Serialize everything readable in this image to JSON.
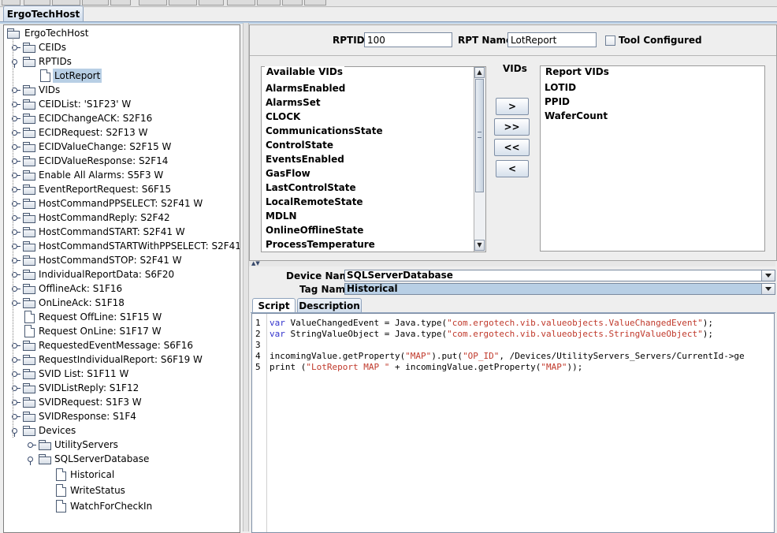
{
  "window": {
    "tab_label": "ErgoTechHost"
  },
  "tree": {
    "root": "ErgoTechHost",
    "items": [
      {
        "label": "CEIDs",
        "kind": "folder",
        "level": 1,
        "toggle": "closed"
      },
      {
        "label": "RPTIDs",
        "kind": "folder",
        "level": 1,
        "toggle": "open"
      },
      {
        "label": "LotReport",
        "kind": "leaf",
        "level": 2,
        "toggle": "none",
        "selected": true
      },
      {
        "label": "VIDs",
        "kind": "folder",
        "level": 1,
        "toggle": "closed"
      },
      {
        "label": "CEIDList: 'S1F23' W",
        "kind": "folder",
        "level": 1,
        "toggle": "closed"
      },
      {
        "label": "ECIDChangeACK: S2F16",
        "kind": "folder",
        "level": 1,
        "toggle": "closed"
      },
      {
        "label": "ECIDRequest: S2F13 W",
        "kind": "folder",
        "level": 1,
        "toggle": "closed"
      },
      {
        "label": "ECIDValueChange: S2F15 W",
        "kind": "folder",
        "level": 1,
        "toggle": "closed"
      },
      {
        "label": "ECIDValueResponse: S2F14",
        "kind": "folder",
        "level": 1,
        "toggle": "closed"
      },
      {
        "label": "Enable All Alarms: S5F3 W",
        "kind": "folder",
        "level": 1,
        "toggle": "closed"
      },
      {
        "label": "EventReportRequest: S6F15",
        "kind": "folder",
        "level": 1,
        "toggle": "closed"
      },
      {
        "label": "HostCommandPPSELECT: S2F41 W",
        "kind": "folder",
        "level": 1,
        "toggle": "closed"
      },
      {
        "label": "HostCommandReply: S2F42",
        "kind": "folder",
        "level": 1,
        "toggle": "closed"
      },
      {
        "label": "HostCommandSTART: S2F41 W",
        "kind": "folder",
        "level": 1,
        "toggle": "closed"
      },
      {
        "label": "HostCommandSTARTWithPPSELECT: S2F41",
        "kind": "folder",
        "level": 1,
        "toggle": "closed"
      },
      {
        "label": "HostCommandSTOP: S2F41 W",
        "kind": "folder",
        "level": 1,
        "toggle": "closed"
      },
      {
        "label": "IndividualReportData: S6F20",
        "kind": "folder",
        "level": 1,
        "toggle": "closed"
      },
      {
        "label": "OfflineAck: S1F16",
        "kind": "folder",
        "level": 1,
        "toggle": "closed"
      },
      {
        "label": "OnLineAck: S1F18",
        "kind": "folder",
        "level": 1,
        "toggle": "closed"
      },
      {
        "label": "Request OffLine: S1F15 W",
        "kind": "leaf",
        "level": 1,
        "toggle": "none"
      },
      {
        "label": "Request OnLine: S1F17 W",
        "kind": "leaf",
        "level": 1,
        "toggle": "none"
      },
      {
        "label": "RequestedEventMessage: S6F16",
        "kind": "folder",
        "level": 1,
        "toggle": "closed"
      },
      {
        "label": "RequestIndividualReport: S6F19 W",
        "kind": "folder",
        "level": 1,
        "toggle": "closed"
      },
      {
        "label": "SVID List: S1F11 W",
        "kind": "folder",
        "level": 1,
        "toggle": "closed"
      },
      {
        "label": "SVIDListReply: S1F12",
        "kind": "folder",
        "level": 1,
        "toggle": "closed"
      },
      {
        "label": "SVIDRequest: S1F3 W",
        "kind": "folder",
        "level": 1,
        "toggle": "closed"
      },
      {
        "label": "SVIDResponse: S1F4",
        "kind": "folder",
        "level": 1,
        "toggle": "closed"
      },
      {
        "label": "Devices",
        "kind": "folder",
        "level": 1,
        "toggle": "open"
      },
      {
        "label": "UtilityServers",
        "kind": "folder",
        "level": 2,
        "toggle": "closed"
      },
      {
        "label": "SQLServerDatabase",
        "kind": "folder",
        "level": 2,
        "toggle": "open"
      },
      {
        "label": "Historical",
        "kind": "leaf",
        "level": 3,
        "toggle": "none"
      },
      {
        "label": "WriteStatus",
        "kind": "leaf",
        "level": 3,
        "toggle": "none"
      },
      {
        "label": "WatchForCheckIn",
        "kind": "leaf",
        "level": 3,
        "toggle": "none"
      }
    ]
  },
  "report": {
    "rptid_label": "RPTID",
    "rptid_value": "100",
    "rpt_name_label": "RPT Name",
    "rpt_name_value": "LotReport",
    "tool_configured_label": "Tool Configured",
    "tool_configured_checked": false,
    "vids_label": "VIDs",
    "available_title": "Available VIDs",
    "available": [
      "AlarmsEnabled",
      "AlarmsSet",
      "CLOCK",
      "CommunicationsState",
      "ControlState",
      "EventsEnabled",
      "GasFlow",
      "LastControlState",
      "LocalRemoteState",
      "MDLN",
      "OnlineOfflineState",
      "ProcessTemperature"
    ],
    "report_title": "Report VIDs",
    "report_vids": [
      "LOTID",
      "PPID",
      "WaferCount"
    ],
    "buttons": {
      "add": ">",
      "add_all": ">>",
      "remove_all": "<<",
      "remove": "<"
    }
  },
  "device": {
    "device_name_label": "Device Name",
    "device_name_value": "SQLServerDatabase",
    "tag_name_label": "Tag Name",
    "tag_name_value": "Historical"
  },
  "editor": {
    "tabs": [
      "Script",
      "Description"
    ],
    "active_tab": "Script",
    "line_numbers": [
      "1",
      "2",
      "3",
      "4",
      "5"
    ],
    "lines": [
      [
        {
          "t": "var",
          "c": "kw"
        },
        {
          "t": " ValueChangedEvent = Java.type(",
          "c": ""
        },
        {
          "t": "\"com.ergotech.vib.valueobjects.ValueChangedEvent\"",
          "c": "str"
        },
        {
          "t": ");",
          "c": ""
        }
      ],
      [
        {
          "t": "var",
          "c": "kw"
        },
        {
          "t": " StringValueObject = Java.type(",
          "c": ""
        },
        {
          "t": "\"com.ergotech.vib.valueobjects.StringValueObject\"",
          "c": "str"
        },
        {
          "t": ");",
          "c": ""
        }
      ],
      [],
      [
        {
          "t": "incomingValue.getProperty(",
          "c": ""
        },
        {
          "t": "\"MAP\"",
          "c": "str"
        },
        {
          "t": ").put(",
          "c": ""
        },
        {
          "t": "\"OP_ID\"",
          "c": "str"
        },
        {
          "t": ", /Devices/UtilityServers_Servers/CurrentId->ge",
          "c": ""
        }
      ],
      [
        {
          "t": "print (",
          "c": ""
        },
        {
          "t": "\"LotReport MAP \"",
          "c": "str"
        },
        {
          "t": " + incomingValue.getProperty(",
          "c": ""
        },
        {
          "t": "\"MAP\"",
          "c": "str"
        },
        {
          "t": "));",
          "c": ""
        }
      ]
    ]
  }
}
